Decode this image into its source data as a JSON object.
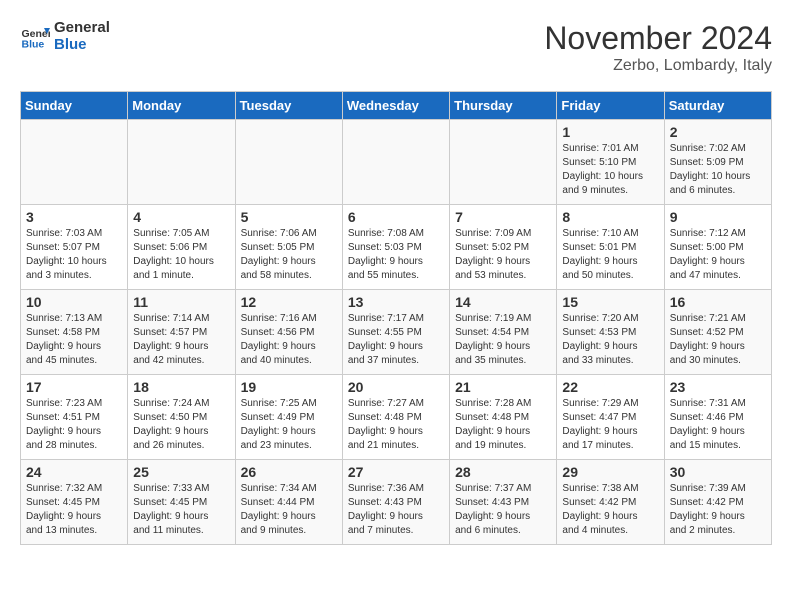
{
  "header": {
    "logo_line1": "General",
    "logo_line2": "Blue",
    "month": "November 2024",
    "location": "Zerbo, Lombardy, Italy"
  },
  "weekdays": [
    "Sunday",
    "Monday",
    "Tuesday",
    "Wednesday",
    "Thursday",
    "Friday",
    "Saturday"
  ],
  "weeks": [
    [
      {
        "day": "",
        "info": ""
      },
      {
        "day": "",
        "info": ""
      },
      {
        "day": "",
        "info": ""
      },
      {
        "day": "",
        "info": ""
      },
      {
        "day": "",
        "info": ""
      },
      {
        "day": "1",
        "info": "Sunrise: 7:01 AM\nSunset: 5:10 PM\nDaylight: 10 hours\nand 9 minutes."
      },
      {
        "day": "2",
        "info": "Sunrise: 7:02 AM\nSunset: 5:09 PM\nDaylight: 10 hours\nand 6 minutes."
      }
    ],
    [
      {
        "day": "3",
        "info": "Sunrise: 7:03 AM\nSunset: 5:07 PM\nDaylight: 10 hours\nand 3 minutes."
      },
      {
        "day": "4",
        "info": "Sunrise: 7:05 AM\nSunset: 5:06 PM\nDaylight: 10 hours\nand 1 minute."
      },
      {
        "day": "5",
        "info": "Sunrise: 7:06 AM\nSunset: 5:05 PM\nDaylight: 9 hours\nand 58 minutes."
      },
      {
        "day": "6",
        "info": "Sunrise: 7:08 AM\nSunset: 5:03 PM\nDaylight: 9 hours\nand 55 minutes."
      },
      {
        "day": "7",
        "info": "Sunrise: 7:09 AM\nSunset: 5:02 PM\nDaylight: 9 hours\nand 53 minutes."
      },
      {
        "day": "8",
        "info": "Sunrise: 7:10 AM\nSunset: 5:01 PM\nDaylight: 9 hours\nand 50 minutes."
      },
      {
        "day": "9",
        "info": "Sunrise: 7:12 AM\nSunset: 5:00 PM\nDaylight: 9 hours\nand 47 minutes."
      }
    ],
    [
      {
        "day": "10",
        "info": "Sunrise: 7:13 AM\nSunset: 4:58 PM\nDaylight: 9 hours\nand 45 minutes."
      },
      {
        "day": "11",
        "info": "Sunrise: 7:14 AM\nSunset: 4:57 PM\nDaylight: 9 hours\nand 42 minutes."
      },
      {
        "day": "12",
        "info": "Sunrise: 7:16 AM\nSunset: 4:56 PM\nDaylight: 9 hours\nand 40 minutes."
      },
      {
        "day": "13",
        "info": "Sunrise: 7:17 AM\nSunset: 4:55 PM\nDaylight: 9 hours\nand 37 minutes."
      },
      {
        "day": "14",
        "info": "Sunrise: 7:19 AM\nSunset: 4:54 PM\nDaylight: 9 hours\nand 35 minutes."
      },
      {
        "day": "15",
        "info": "Sunrise: 7:20 AM\nSunset: 4:53 PM\nDaylight: 9 hours\nand 33 minutes."
      },
      {
        "day": "16",
        "info": "Sunrise: 7:21 AM\nSunset: 4:52 PM\nDaylight: 9 hours\nand 30 minutes."
      }
    ],
    [
      {
        "day": "17",
        "info": "Sunrise: 7:23 AM\nSunset: 4:51 PM\nDaylight: 9 hours\nand 28 minutes."
      },
      {
        "day": "18",
        "info": "Sunrise: 7:24 AM\nSunset: 4:50 PM\nDaylight: 9 hours\nand 26 minutes."
      },
      {
        "day": "19",
        "info": "Sunrise: 7:25 AM\nSunset: 4:49 PM\nDaylight: 9 hours\nand 23 minutes."
      },
      {
        "day": "20",
        "info": "Sunrise: 7:27 AM\nSunset: 4:48 PM\nDaylight: 9 hours\nand 21 minutes."
      },
      {
        "day": "21",
        "info": "Sunrise: 7:28 AM\nSunset: 4:48 PM\nDaylight: 9 hours\nand 19 minutes."
      },
      {
        "day": "22",
        "info": "Sunrise: 7:29 AM\nSunset: 4:47 PM\nDaylight: 9 hours\nand 17 minutes."
      },
      {
        "day": "23",
        "info": "Sunrise: 7:31 AM\nSunset: 4:46 PM\nDaylight: 9 hours\nand 15 minutes."
      }
    ],
    [
      {
        "day": "24",
        "info": "Sunrise: 7:32 AM\nSunset: 4:45 PM\nDaylight: 9 hours\nand 13 minutes."
      },
      {
        "day": "25",
        "info": "Sunrise: 7:33 AM\nSunset: 4:45 PM\nDaylight: 9 hours\nand 11 minutes."
      },
      {
        "day": "26",
        "info": "Sunrise: 7:34 AM\nSunset: 4:44 PM\nDaylight: 9 hours\nand 9 minutes."
      },
      {
        "day": "27",
        "info": "Sunrise: 7:36 AM\nSunset: 4:43 PM\nDaylight: 9 hours\nand 7 minutes."
      },
      {
        "day": "28",
        "info": "Sunrise: 7:37 AM\nSunset: 4:43 PM\nDaylight: 9 hours\nand 6 minutes."
      },
      {
        "day": "29",
        "info": "Sunrise: 7:38 AM\nSunset: 4:42 PM\nDaylight: 9 hours\nand 4 minutes."
      },
      {
        "day": "30",
        "info": "Sunrise: 7:39 AM\nSunset: 4:42 PM\nDaylight: 9 hours\nand 2 minutes."
      }
    ]
  ]
}
